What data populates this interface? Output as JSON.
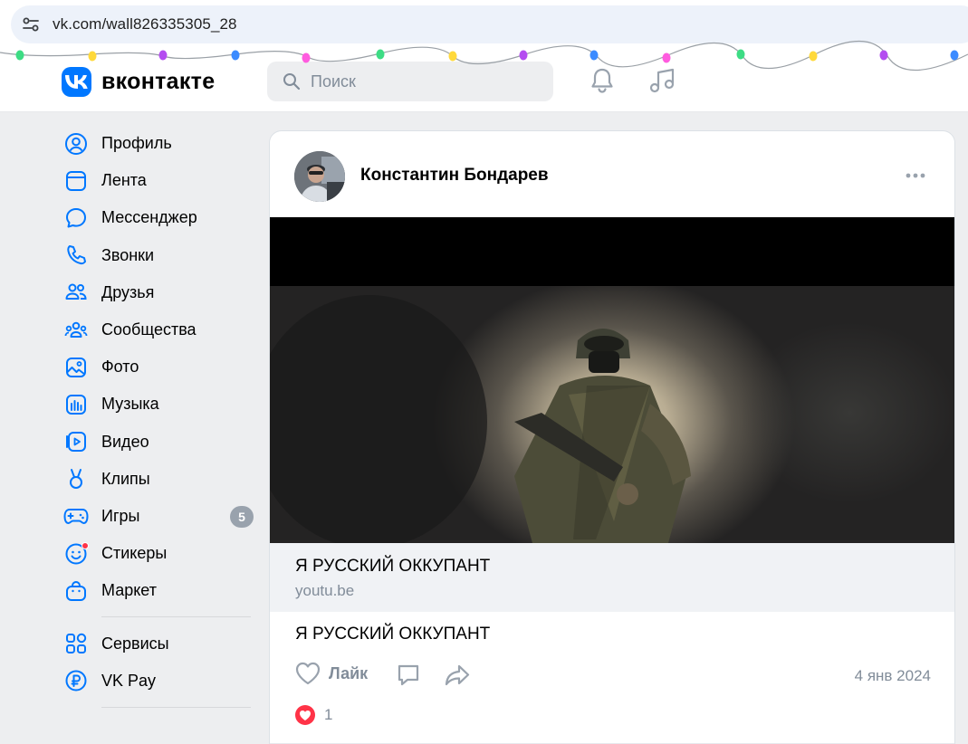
{
  "browser": {
    "url": "vk.com/wall826335305_28"
  },
  "header": {
    "brand": "вконтакте",
    "search_placeholder": "Поиск"
  },
  "sidebar": {
    "items": [
      {
        "label": "Профиль",
        "icon": "profile-icon"
      },
      {
        "label": "Лента",
        "icon": "feed-icon"
      },
      {
        "label": "Мессенджер",
        "icon": "messenger-icon"
      },
      {
        "label": "Звонки",
        "icon": "phone-icon"
      },
      {
        "label": "Друзья",
        "icon": "friends-icon"
      },
      {
        "label": "Сообщества",
        "icon": "communities-icon"
      },
      {
        "label": "Фото",
        "icon": "photo-icon"
      },
      {
        "label": "Музыка",
        "icon": "music-icon"
      },
      {
        "label": "Видео",
        "icon": "video-icon"
      },
      {
        "label": "Клипы",
        "icon": "clips-icon"
      },
      {
        "label": "Игры",
        "icon": "games-icon",
        "badge": "5"
      },
      {
        "label": "Стикеры",
        "icon": "stickers-icon"
      },
      {
        "label": "Маркет",
        "icon": "market-icon"
      }
    ],
    "extra": [
      {
        "label": "Сервисы",
        "icon": "services-icon"
      },
      {
        "label": "VK Pay",
        "icon": "vkpay-icon"
      }
    ]
  },
  "post": {
    "author": "Константин Бондарев",
    "link_title": "Я РУССКИЙ ОККУПАНТ",
    "link_domain": "youtu.be",
    "text": "Я РУССКИЙ ОККУПАНТ",
    "like_label": "Лайк",
    "date": "4 янв 2024",
    "reactions_count": "1"
  },
  "colors": {
    "accent": "#0077ff",
    "secondary_text": "#818c99",
    "like_red": "#ff3347"
  }
}
